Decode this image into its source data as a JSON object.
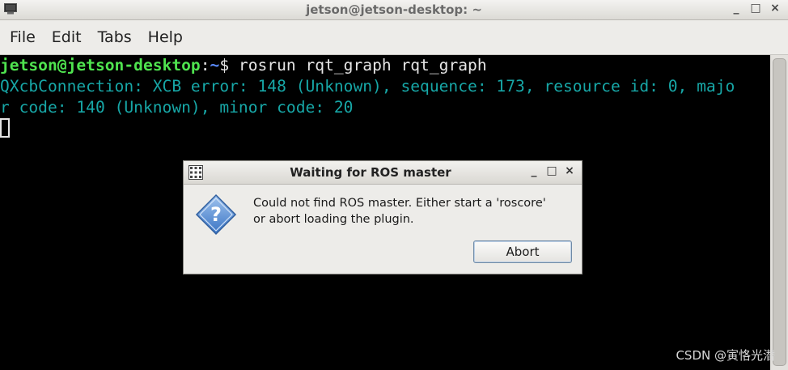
{
  "window": {
    "title": "jetson@jetson-desktop: ~",
    "controls": {
      "minimize": "_",
      "maximize": "□",
      "close": "×"
    }
  },
  "menu": {
    "items": [
      "File",
      "Edit",
      "Tabs",
      "Help"
    ]
  },
  "terminal": {
    "prompt_user": "jetson@jetson-desktop",
    "prompt_colon": ":",
    "prompt_path": "~",
    "prompt_symbol": "$ ",
    "command": "rosrun rqt_graph rqt_graph",
    "error_line1": "QXcbConnection: XCB error: 148 (Unknown), sequence: 173, resource id: 0, majo",
    "error_line2": "r code: 140 (Unknown), minor code: 20"
  },
  "dialog": {
    "title": "Waiting for ROS master",
    "message_line1": "Could not find ROS master. Either start a 'roscore'",
    "message_line2": "or abort loading the plugin.",
    "button_abort": "Abort",
    "controls": {
      "minimize": "_",
      "maximize": "□",
      "close": "×"
    }
  },
  "watermark": "CSDN @寅恪光潜",
  "colors": {
    "prompt_user": "#4fe34f",
    "prompt_path": "#5b8cff",
    "error_text": "#17a7a7",
    "terminal_bg": "#000000"
  }
}
